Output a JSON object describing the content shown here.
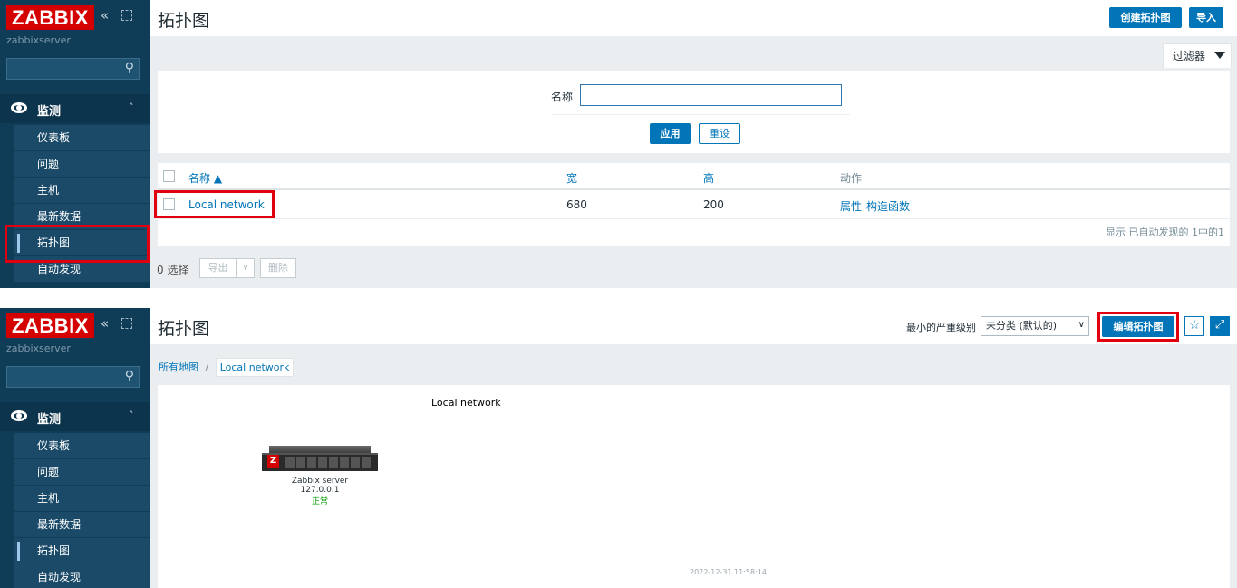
{
  "brand": {
    "logo": "ZABBIX",
    "server": "zabbixserver"
  },
  "sidebar": {
    "section": "监测",
    "items": [
      {
        "label": "仪表板"
      },
      {
        "label": "问题"
      },
      {
        "label": "主机"
      },
      {
        "label": "最新数据"
      },
      {
        "label": "拓扑图"
      },
      {
        "label": "自动发现"
      }
    ]
  },
  "panel1": {
    "title": "拓扑图",
    "create_btn": "创建拓扑图",
    "import_btn": "导入",
    "filter_tab": "过滤器",
    "filter": {
      "name_label": "名称",
      "name_value": "",
      "apply": "应用",
      "reset": "重设"
    },
    "table": {
      "headers": {
        "name": "名称 ▲",
        "width": "宽",
        "height": "高",
        "actions": "动作"
      },
      "row": {
        "name": "Local network",
        "width": "680",
        "height": "200",
        "prop": "属性",
        "constructor": "构造函数"
      },
      "footer": "显示 已自动发现的 1中的1"
    },
    "bulk": {
      "selected": "0 选择",
      "export": "导出",
      "delete": "删除"
    }
  },
  "panel2": {
    "title": "拓扑图",
    "min_severity_label": "最小的严重级别",
    "min_severity_value": "未分类 (默认的)",
    "edit_btn": "编辑拓扑图",
    "breadcrumb": {
      "home": "所有地图",
      "sep": "/",
      "current": "Local network"
    },
    "map": {
      "title": "Local network",
      "host_name": "Zabbix server",
      "host_ip": "127.0.0.1",
      "host_status": "正常",
      "timestamp": "2022-12-31 11:58:14"
    }
  },
  "colors": {
    "accent": "#0275b8",
    "brand": "#d40000",
    "sidebar": "#0f3d58",
    "ok": "#009900",
    "highlight": "#e00010"
  }
}
